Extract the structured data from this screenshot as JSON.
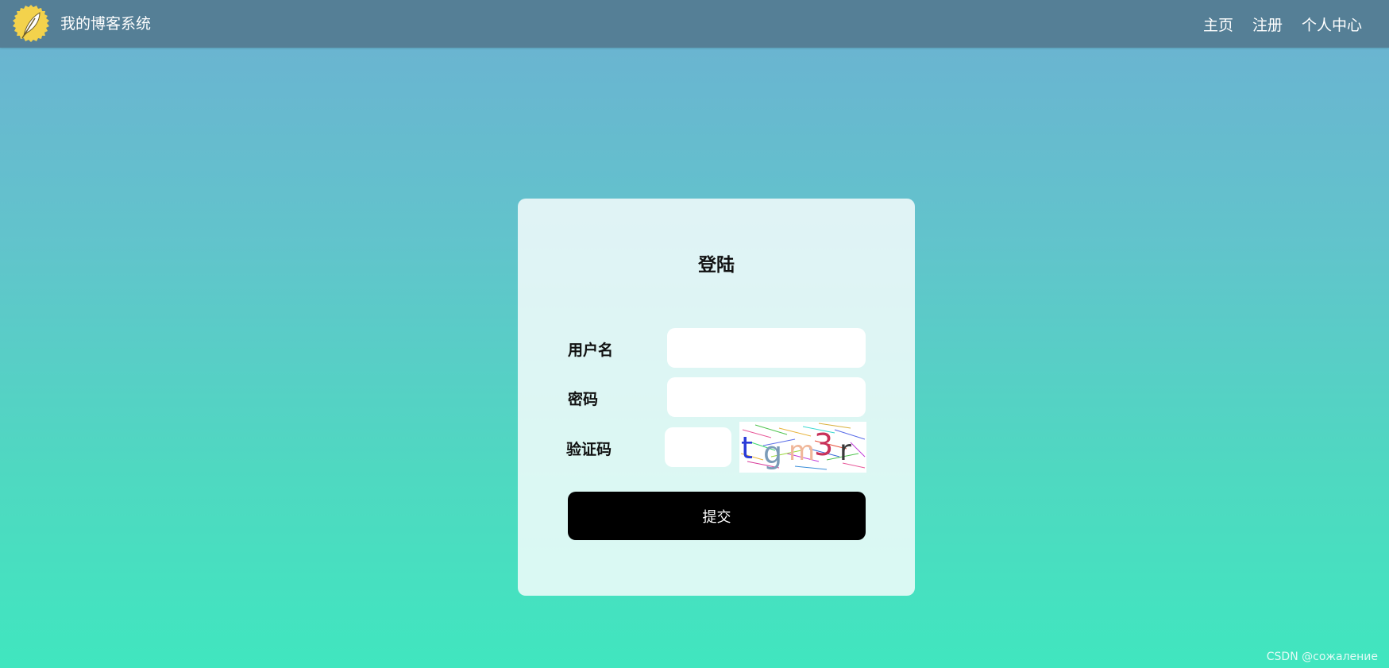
{
  "nav": {
    "logo_icon": "feather-quill-icon",
    "site_title": "我的博客系统",
    "links": [
      {
        "label": "主页"
      },
      {
        "label": "注册"
      },
      {
        "label": "个人中心"
      }
    ]
  },
  "login": {
    "title": "登陆",
    "username_label": "用户名",
    "username_value": "",
    "password_label": "密码",
    "password_value": "",
    "captcha_label": "验证码",
    "captcha_value": "",
    "captcha_text": "tgm3r",
    "submit_label": "提交"
  },
  "watermark": "CSDN @сожаление",
  "colors": {
    "nav_bg": "#557f96",
    "bg_top": "#6cb1d2",
    "bg_bottom": "#40e6bf",
    "button_bg": "#000000",
    "logo_bg": "#f3d24c"
  }
}
